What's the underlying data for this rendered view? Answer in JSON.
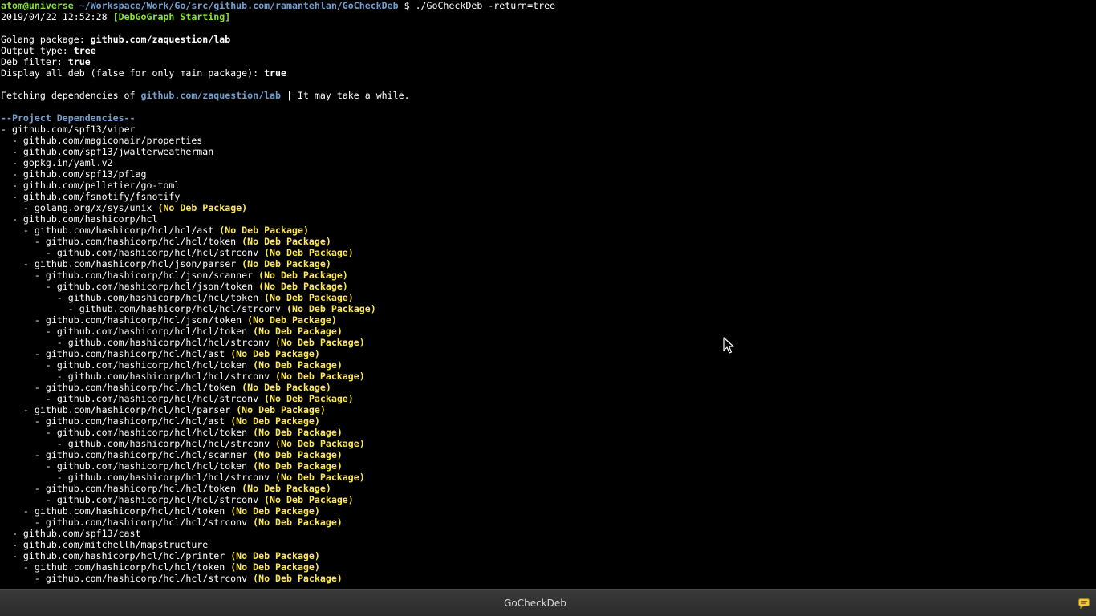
{
  "prompt": {
    "user_host": "atom@universe",
    "path": "~/Workspace/Work/Go/src/github.com/ramantehlan/GoCheckDeb",
    "dollar": "$",
    "command": "./GoCheckDeb -return=tree"
  },
  "start_line": {
    "timestamp": "2019/04/22 12:52:28",
    "status": "[DebGoGraph Starting]"
  },
  "config": {
    "package_label": "Golang package:",
    "package_value": "github.com/zaquestion/lab",
    "output_label": "Output type:",
    "output_value": "tree",
    "filter_label": "Deb filter:",
    "filter_value": "true",
    "display_label": "Display all deb (false for only main package):",
    "display_value": "true"
  },
  "fetching": {
    "prefix": "Fetching dependencies of",
    "package": "github.com/zaquestion/lab",
    "suffix": "| It may take a while."
  },
  "section_header": "--Project Dependencies--",
  "no_deb_label": "(No Deb Package)",
  "tree": [
    {
      "indent": "",
      "name": "github.com/spf13/viper",
      "nodeb": false
    },
    {
      "indent": "  ",
      "name": "github.com/magiconair/properties",
      "nodeb": false
    },
    {
      "indent": "  ",
      "name": "github.com/spf13/jwalterweatherman",
      "nodeb": false
    },
    {
      "indent": "  ",
      "name": "gopkg.in/yaml.v2",
      "nodeb": false
    },
    {
      "indent": "  ",
      "name": "github.com/spf13/pflag",
      "nodeb": false
    },
    {
      "indent": "  ",
      "name": "github.com/pelletier/go-toml",
      "nodeb": false
    },
    {
      "indent": "  ",
      "name": "github.com/fsnotify/fsnotify",
      "nodeb": false
    },
    {
      "indent": "    ",
      "name": "golang.org/x/sys/unix",
      "nodeb": true
    },
    {
      "indent": "  ",
      "name": "github.com/hashicorp/hcl",
      "nodeb": false
    },
    {
      "indent": "    ",
      "name": "github.com/hashicorp/hcl/hcl/ast",
      "nodeb": true
    },
    {
      "indent": "      ",
      "name": "github.com/hashicorp/hcl/hcl/token",
      "nodeb": true
    },
    {
      "indent": "        ",
      "name": "github.com/hashicorp/hcl/hcl/strconv",
      "nodeb": true
    },
    {
      "indent": "    ",
      "name": "github.com/hashicorp/hcl/json/parser",
      "nodeb": true
    },
    {
      "indent": "      ",
      "name": "github.com/hashicorp/hcl/json/scanner",
      "nodeb": true
    },
    {
      "indent": "        ",
      "name": "github.com/hashicorp/hcl/json/token",
      "nodeb": true
    },
    {
      "indent": "          ",
      "name": "github.com/hashicorp/hcl/hcl/token",
      "nodeb": true
    },
    {
      "indent": "            ",
      "name": "github.com/hashicorp/hcl/hcl/strconv",
      "nodeb": true
    },
    {
      "indent": "      ",
      "name": "github.com/hashicorp/hcl/json/token",
      "nodeb": true
    },
    {
      "indent": "        ",
      "name": "github.com/hashicorp/hcl/hcl/token",
      "nodeb": true
    },
    {
      "indent": "          ",
      "name": "github.com/hashicorp/hcl/hcl/strconv",
      "nodeb": true
    },
    {
      "indent": "      ",
      "name": "github.com/hashicorp/hcl/hcl/ast",
      "nodeb": true
    },
    {
      "indent": "        ",
      "name": "github.com/hashicorp/hcl/hcl/token",
      "nodeb": true
    },
    {
      "indent": "          ",
      "name": "github.com/hashicorp/hcl/hcl/strconv",
      "nodeb": true
    },
    {
      "indent": "      ",
      "name": "github.com/hashicorp/hcl/hcl/token",
      "nodeb": true
    },
    {
      "indent": "        ",
      "name": "github.com/hashicorp/hcl/hcl/strconv",
      "nodeb": true
    },
    {
      "indent": "    ",
      "name": "github.com/hashicorp/hcl/hcl/parser",
      "nodeb": true
    },
    {
      "indent": "      ",
      "name": "github.com/hashicorp/hcl/hcl/ast",
      "nodeb": true
    },
    {
      "indent": "        ",
      "name": "github.com/hashicorp/hcl/hcl/token",
      "nodeb": true
    },
    {
      "indent": "          ",
      "name": "github.com/hashicorp/hcl/hcl/strconv",
      "nodeb": true
    },
    {
      "indent": "      ",
      "name": "github.com/hashicorp/hcl/hcl/scanner",
      "nodeb": true
    },
    {
      "indent": "        ",
      "name": "github.com/hashicorp/hcl/hcl/token",
      "nodeb": true
    },
    {
      "indent": "          ",
      "name": "github.com/hashicorp/hcl/hcl/strconv",
      "nodeb": true
    },
    {
      "indent": "      ",
      "name": "github.com/hashicorp/hcl/hcl/token",
      "nodeb": true
    },
    {
      "indent": "        ",
      "name": "github.com/hashicorp/hcl/hcl/strconv",
      "nodeb": true
    },
    {
      "indent": "    ",
      "name": "github.com/hashicorp/hcl/hcl/token",
      "nodeb": true
    },
    {
      "indent": "      ",
      "name": "github.com/hashicorp/hcl/hcl/strconv",
      "nodeb": true
    },
    {
      "indent": "  ",
      "name": "github.com/spf13/cast",
      "nodeb": false
    },
    {
      "indent": "  ",
      "name": "github.com/mitchellh/mapstructure",
      "nodeb": false
    },
    {
      "indent": "  ",
      "name": "github.com/hashicorp/hcl/hcl/printer",
      "nodeb": true
    },
    {
      "indent": "    ",
      "name": "github.com/hashicorp/hcl/hcl/token",
      "nodeb": true
    },
    {
      "indent": "      ",
      "name": "github.com/hashicorp/hcl/hcl/strconv",
      "nodeb": true
    }
  ],
  "taskbar": {
    "window_title": "GoCheckDeb"
  },
  "icons": {
    "cursor": "mouse-pointer-icon",
    "tray": "notification-icon"
  },
  "colors": {
    "background": "#000000",
    "prompt_green": "#8ae234",
    "path_blue": "#729fcf",
    "warning_yellow": "#fce94f",
    "taskbar": "#2e2e2e"
  }
}
